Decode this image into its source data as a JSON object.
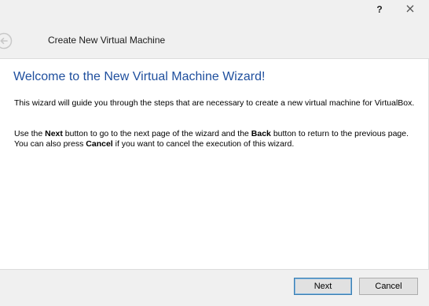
{
  "titlebar": {
    "help_label": "?"
  },
  "header": {
    "title": "Create New Virtual Machine"
  },
  "content": {
    "heading": "Welcome to the New Virtual Machine Wizard!",
    "para1": "This wizard will guide you through the steps that are necessary to create a new virtual machine for VirtualBox.",
    "para2": {
      "t1": "Use the ",
      "b1": "Next",
      "t2": " button to go to the next page of the wizard and the ",
      "b2": "Back",
      "t3": " button to return to the previous page. You can also press ",
      "b3": "Cancel",
      "t4": " if you want to cancel the execution of this wizard."
    }
  },
  "footer": {
    "next_label": "Next",
    "cancel_label": "Cancel"
  },
  "colors": {
    "heading": "#1f4f9e",
    "chrome": "#f0f0f0",
    "default_button_border": "#3c7fb1"
  },
  "icons": {
    "back": "back-arrow-icon",
    "close": "close-icon"
  }
}
